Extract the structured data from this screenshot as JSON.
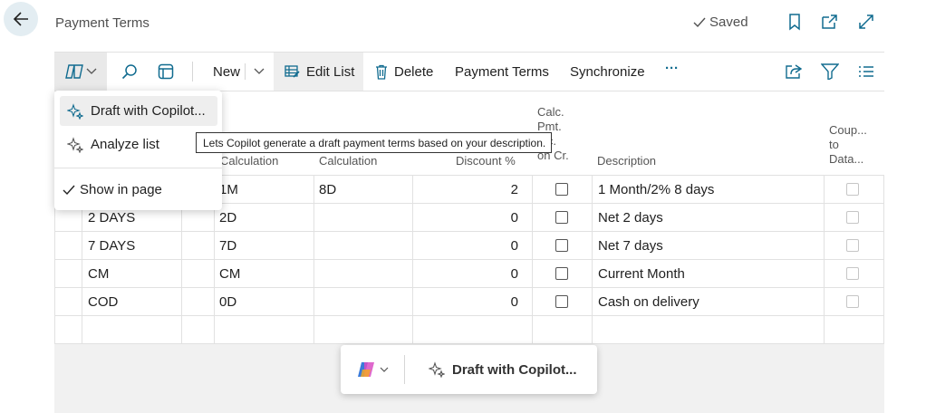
{
  "header": {
    "title": "Payment Terms",
    "saved_label": "Saved",
    "icons": [
      "back-arrow-icon",
      "checkmark-icon",
      "bookmark-icon",
      "open-new-window-icon",
      "expand-icon"
    ]
  },
  "toolbar": {
    "new_label": "New",
    "edit_list_label": "Edit List",
    "delete_label": "Delete",
    "payment_terms_label": "Payment Terms",
    "synchronize_label": "Synchronize",
    "more_label": "···"
  },
  "copilot_menu": {
    "draft_label": "Draft with Copilot...",
    "analyze_label": "Analyze list",
    "show_label": "Show in page"
  },
  "tooltip": "Lets Copilot generate a draft payment terms based on your description.",
  "columns": {
    "due_calc": "Calculation",
    "discount_calc": "Calculation",
    "discount_pct": "Discount %",
    "calc_pmt_1": "Calc.",
    "calc_pmt_2": "Pmt.",
    "calc_pmt_3": "...c.",
    "calc_pmt_4": "on Cr.",
    "description": "Description",
    "coupled_1": "Coup...",
    "coupled_2": "to",
    "coupled_3": "Data..."
  },
  "rows": [
    {
      "code": "",
      "due": "1M",
      "disc_calc": "8D",
      "disc_pct": "2",
      "desc": "1 Month/2% 8 days"
    },
    {
      "code": "2 DAYS",
      "due": "2D",
      "disc_calc": "",
      "disc_pct": "0",
      "desc": "Net 2 days"
    },
    {
      "code": "7 DAYS",
      "due": "7D",
      "disc_calc": "",
      "disc_pct": "0",
      "desc": "Net 7 days"
    },
    {
      "code": "CM",
      "due": "CM",
      "disc_calc": "",
      "disc_pct": "0",
      "desc": "Current Month"
    },
    {
      "code": "COD",
      "due": "0D",
      "disc_calc": "",
      "disc_pct": "0",
      "desc": "Cash on delivery"
    }
  ],
  "copilot_bar": {
    "draft_label": "Draft with Copilot..."
  },
  "colors": {
    "accent": "#106b8f",
    "back_button_bg": "#e3edf2",
    "bottom_area_bg": "#f1f1f1"
  }
}
